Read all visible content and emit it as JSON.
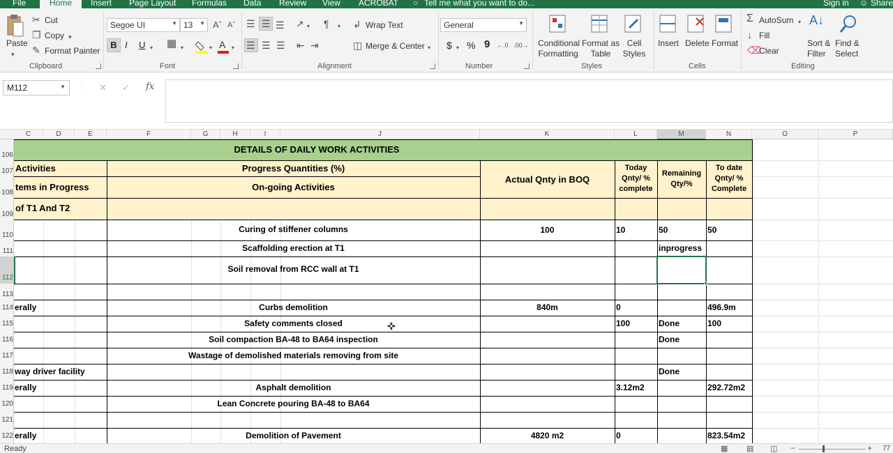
{
  "ribbon_tabs": [
    "File",
    "Home",
    "Insert",
    "Page Layout",
    "Formulas",
    "Data",
    "Review",
    "View",
    "ACROBAT"
  ],
  "tell_me": "Tell me what you want to do...",
  "sign_in": "Sign in",
  "share": "Share",
  "clipboard": {
    "paste": "Paste",
    "cut": "Cut",
    "copy": "Copy",
    "format_painter": "Format Painter",
    "label": "Clipboard"
  },
  "font": {
    "name": "Segoe UI",
    "size": "13",
    "bold": "B",
    "italic": "I",
    "underline": "U",
    "label": "Font"
  },
  "alignment": {
    "wrap_text": "Wrap Text",
    "merge_center": "Merge & Center",
    "label": "Alignment"
  },
  "number": {
    "format": "General",
    "currency": "$",
    "percent": "%",
    "comma": "9",
    "label": "Number"
  },
  "styles": {
    "conditional": "Conditional Formatting",
    "format_table": "Format as Table",
    "cell_styles": "Cell Styles",
    "label": "Styles"
  },
  "cells": {
    "insert": "Insert",
    "delete": "Delete",
    "format": "Format",
    "label": "Cells"
  },
  "editing": {
    "autosum": "AutoSum",
    "fill": "Fill",
    "clear": "Clear",
    "sort_filter": "Sort & Filter",
    "find_select": "Find & Select",
    "label": "Editing"
  },
  "formula_bar": {
    "name_box": "M112",
    "fx": "fx",
    "cancel": "✕",
    "enter": "✓",
    "content": ""
  },
  "columns": [
    "C",
    "D",
    "E",
    "F",
    "G",
    "H",
    "I",
    "J",
    "K",
    "L",
    "M",
    "N",
    "O",
    "P"
  ],
  "rows": [
    "106",
    "107",
    "108",
    "109",
    "110",
    "111",
    "112",
    "113",
    "114",
    "115",
    "116",
    "117",
    "118",
    "119",
    "120",
    "121",
    "122"
  ],
  "sheet": {
    "title": "DETAILS OF DAILY WORK ACTIVITIES",
    "h_activities": "Activities",
    "h_progress": "Progress Quantities (%)",
    "h_items": "tems in Progress",
    "h_ongoing": "On-going Activities",
    "h_actual": "Actual Qnty in BOQ",
    "h_today": "Today Qnty/ % complete",
    "h_remaining": "Remaining Qty/%",
    "h_todate": "To date Qnty/ % Complete",
    "h_section": "of T1 And T2",
    "r110": {
      "activity": "Curing of stiffener columns",
      "actual": "100",
      "today": "10",
      "remaining": "50",
      "todate": "50"
    },
    "r111": {
      "activity": "Scaffolding erection at T1",
      "remaining": "inprogress"
    },
    "r112": {
      "activity": "Soil removal from RCC wall at T1"
    },
    "r114": {
      "left": "erally",
      "activity": "Curbs demolition",
      "actual": "840m",
      "today": "0",
      "todate": "496.9m"
    },
    "r115": {
      "activity": "Safety comments closed",
      "today": "100",
      "remaining": "Done",
      "todate": "100"
    },
    "r116": {
      "activity": "Soil compaction BA-48 to BA64 inspection",
      "remaining": "Done"
    },
    "r117": {
      "activity": "Wastage of  demolished materials removing from site"
    },
    "r118": {
      "left": "way driver facility",
      "remaining": "Done"
    },
    "r119": {
      "left": "erally",
      "activity": "Asphalt demolition",
      "today": "3.12m2",
      "todate": "292.72m2"
    },
    "r120": {
      "activity": "Lean Concrete pouring BA-48 to BA64"
    },
    "r122": {
      "left": "erally",
      "activity": "Demolition of Pavement",
      "actual": "4820 m2",
      "today": "0",
      "todate": "823.54m2"
    }
  },
  "status": {
    "ready": "Ready",
    "zoom": "77"
  },
  "colors": {
    "excel_green": "#217346",
    "header_green": "#a9d08e",
    "header_cream": "#fff2cc"
  }
}
